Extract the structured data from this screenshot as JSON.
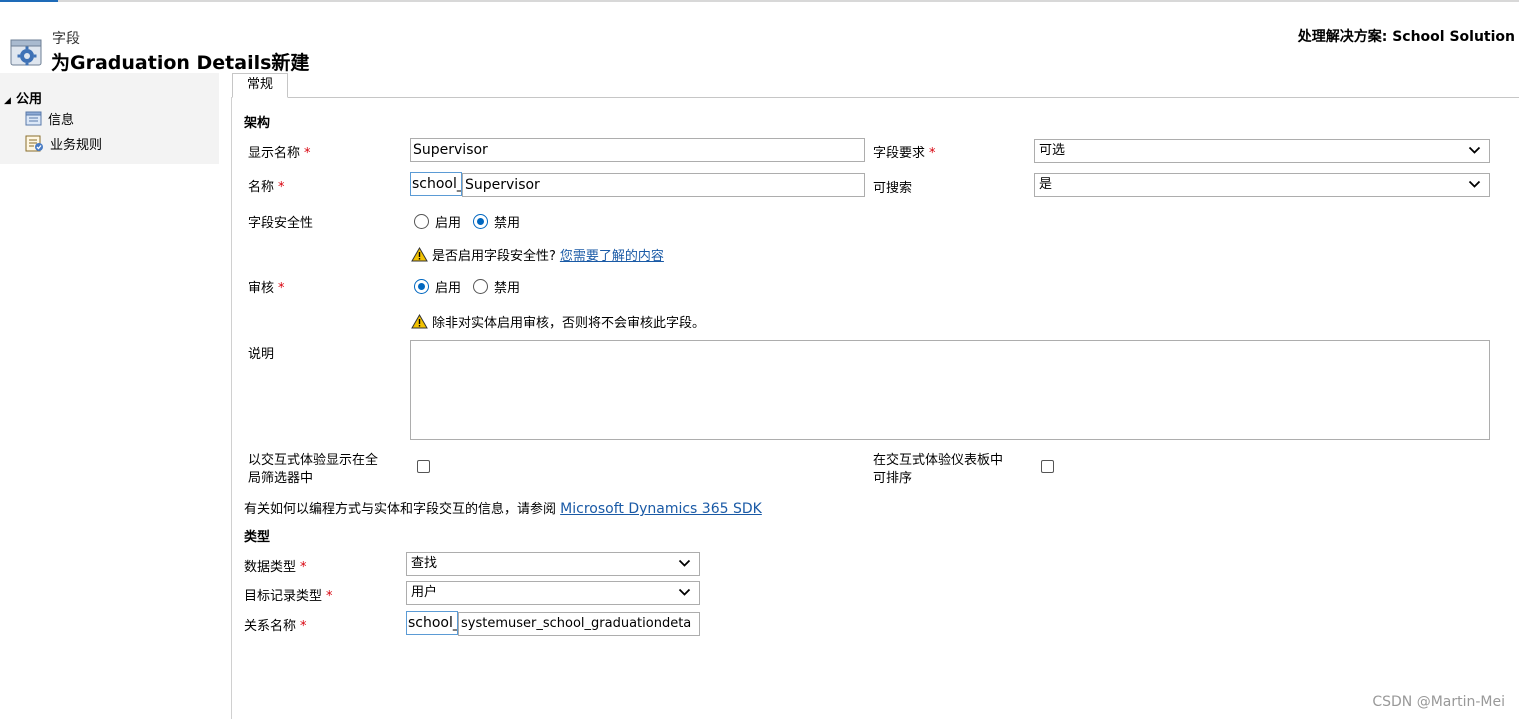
{
  "header": {
    "entity_label": "字段",
    "title": "为Graduation Details新建",
    "solution": "处理解决方案: School Solution"
  },
  "nav": {
    "group_label": "公用",
    "items": [
      {
        "label": "信息",
        "icon": "info-page-icon"
      },
      {
        "label": "业务规则",
        "icon": "business-rules-icon"
      }
    ]
  },
  "tabs": [
    {
      "label": "常规"
    }
  ],
  "schema": {
    "section_title": "架构",
    "display_name": {
      "label": "显示名称",
      "value": "Supervisor"
    },
    "name": {
      "label": "名称",
      "prefix": "school_",
      "value": "Supervisor"
    },
    "field_requirement": {
      "label": "字段要求",
      "selected": "可选"
    },
    "searchable": {
      "label": "可搜索",
      "selected": "是"
    },
    "field_security": {
      "label": "字段安全性",
      "options": [
        "启用",
        "禁用"
      ],
      "selected": "禁用",
      "warning_text": "是否启用字段安全性?",
      "warning_link": "您需要了解的内容"
    },
    "auditing": {
      "label": "审核",
      "options": [
        "启用",
        "禁用"
      ],
      "selected": "启用",
      "warning_text": "除非对实体启用审核，否则将不会审核此字段。"
    },
    "description": {
      "label": "说明",
      "value": ""
    },
    "global_filter": {
      "label_line1": "以交互式体验显示在全",
      "label_line2": "局筛选器中",
      "checked": false
    },
    "sortable": {
      "label_line1": "在交互式体验仪表板中",
      "label_line2": "可排序",
      "checked": false
    },
    "sdk_note": "有关如何以编程方式与实体和字段交互的信息，请参阅",
    "sdk_link": "Microsoft Dynamics 365 SDK"
  },
  "type": {
    "section_title": "类型",
    "data_type": {
      "label": "数据类型",
      "selected": "查找"
    },
    "target_record_type": {
      "label": "目标记录类型",
      "selected": "用户"
    },
    "relationship_name": {
      "label": "关系名称",
      "prefix": "school_",
      "value": "systemuser_school_graduationdeta"
    }
  },
  "watermark": "CSDN @Martin-Mei",
  "colors": {
    "accent": "#1e6bb8",
    "link": "#1a5aa6",
    "required": "#d8000c",
    "radio": "#0067c0",
    "warning": "#f2c200"
  }
}
